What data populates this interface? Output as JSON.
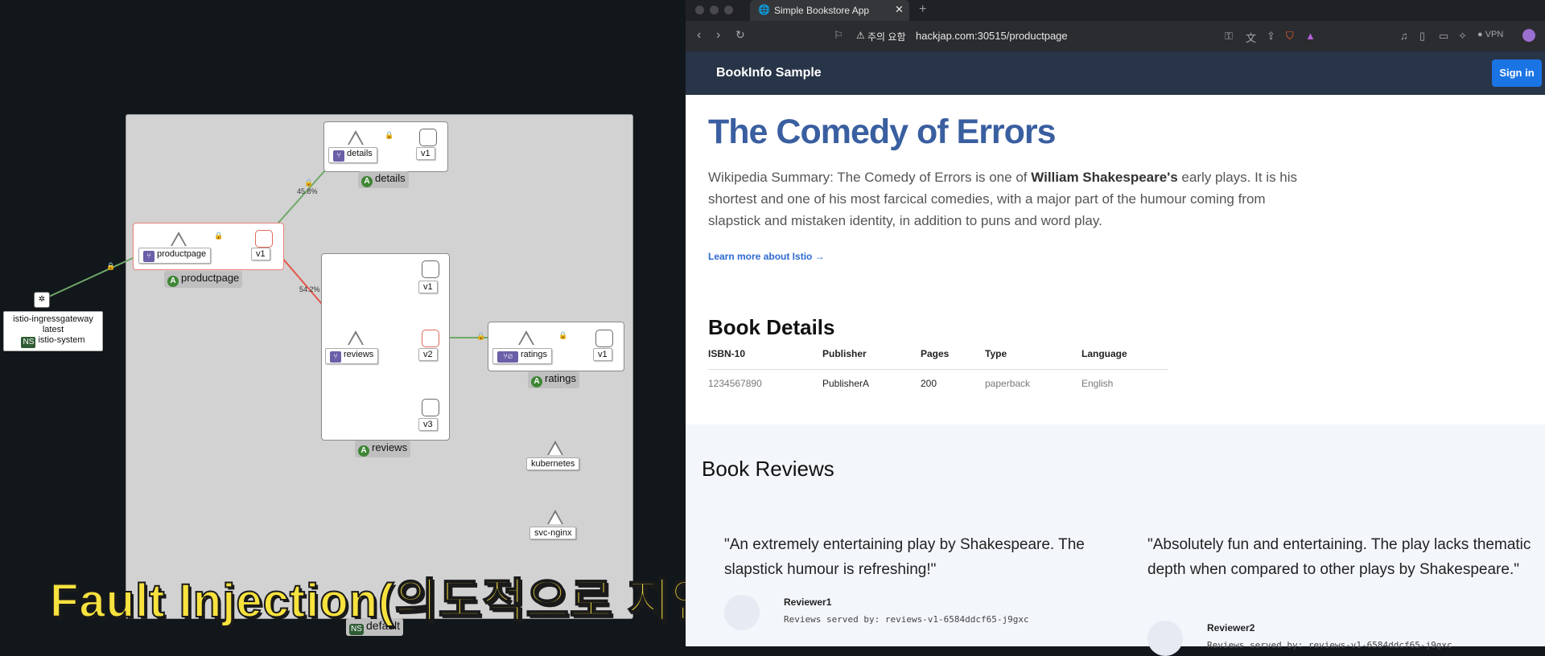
{
  "graph": {
    "namespace": "default",
    "ingress": {
      "name": "istio-ingressgateway",
      "version": "latest",
      "ns_badge": "NS",
      "namespace": "istio-system"
    },
    "details": {
      "service": "details",
      "version": "v1",
      "app": "details",
      "edge_pct": "45.8%"
    },
    "productpage": {
      "service": "productpage",
      "version": "v1",
      "app": "productpage"
    },
    "reviews": {
      "service": "reviews",
      "versions": [
        "v1",
        "v2",
        "v3"
      ],
      "app": "reviews",
      "edge_pct": "54.2%"
    },
    "ratings": {
      "service": "ratings",
      "version": "v1",
      "app": "ratings"
    },
    "kubernetes": "kubernetes",
    "svc_nginx": "svc-nginx",
    "app_badge": "A",
    "ns_badge": "NS"
  },
  "caption": "Fault Injection(의도적으로 지연 발생)",
  "browser": {
    "tab_title": "Simple Bookstore App",
    "security_warning": "주의 요함",
    "url": "hackjap.com:30515/productpage",
    "vpn_label": "VPN"
  },
  "page": {
    "brand": "BookInfo Sample",
    "sign_in": "Sign in",
    "title": "The Comedy of Errors",
    "summary_prefix": "Wikipedia Summary: The Comedy of Errors is one of ",
    "summary_bold": "William Shakespeare's",
    "summary_suffix": " early plays. It is his shortest and one of his most farcical comedies, with a major part of the humour coming from slapstick and mistaken identity, in addition to puns and word play.",
    "learn_more": "Learn more about Istio →",
    "book_details_title": "Book Details",
    "details_headers": [
      "ISBN-10",
      "Publisher",
      "Pages",
      "Type",
      "Language"
    ],
    "details_row": [
      "1234567890",
      "PublisherA",
      "200",
      "paperback",
      "English"
    ],
    "book_reviews_title": "Book Reviews",
    "reviews": [
      {
        "quote": "\"An extremely entertaining play by Shakespeare. The slapstick humour is refreshing!\"",
        "reviewer": "Reviewer1",
        "served": "Reviews served by: reviews-v1-6584ddcf65-j9gxc"
      },
      {
        "quote": "\"Absolutely fun and entertaining. The play lacks thematic depth when compared to other plays by Shakespeare.\"",
        "reviewer": "Reviewer2",
        "served": "Reviews served by: reviews-v1-6584ddcf65-j9gxc"
      }
    ]
  },
  "colors": {
    "edge_ok": "#6fa869",
    "edge_err": "#e2574c",
    "title": "#3a5fa0",
    "navbar": "#283447",
    "signin": "#1b74e4"
  }
}
